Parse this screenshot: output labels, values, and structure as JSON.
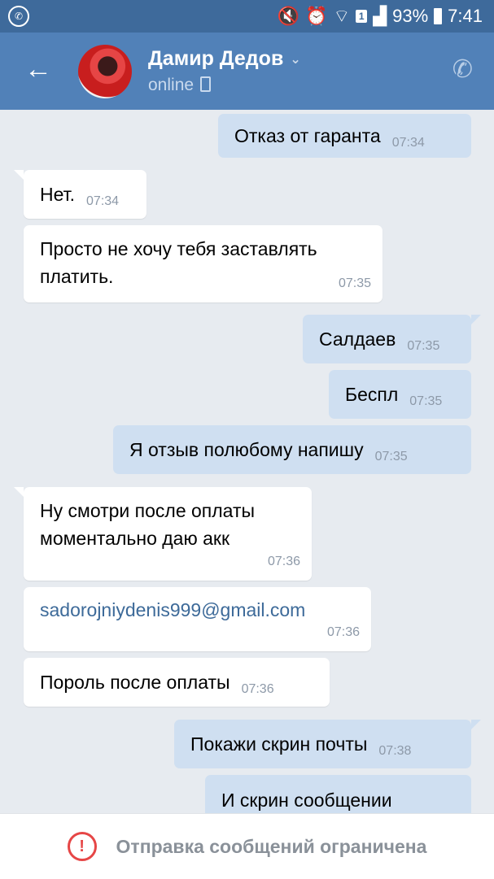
{
  "status_bar": {
    "battery": "93%",
    "time": "7:41",
    "sim": "1",
    "icons": [
      "whatsapp-icon",
      "mute-icon",
      "alarm-icon",
      "wifi-icon",
      "sim-icon",
      "signal-icon",
      "battery-icon"
    ]
  },
  "header": {
    "name": "Дамир Дедов",
    "status": "online"
  },
  "messages": [
    {
      "dir": "out",
      "text": "Отказ от гаранта",
      "time": "07:34"
    },
    {
      "dir": "in",
      "text": "Нет.",
      "time": "07:34"
    },
    {
      "dir": "in",
      "text": "Просто не хочу тебя заставлять платить.",
      "time": "07:35"
    },
    {
      "dir": "out",
      "text": "Салдаев",
      "time": "07:35"
    },
    {
      "dir": "out",
      "text": "Беспл",
      "time": "07:35"
    },
    {
      "dir": "out",
      "text": "Я отзыв полюбому напишу",
      "time": "07:35"
    },
    {
      "dir": "in",
      "text": "Ну смотри после оплаты моментально даю акк",
      "time": "07:36"
    },
    {
      "dir": "in",
      "text": "sadorojniydenis999@gmail.com",
      "time": "07:36",
      "link": true
    },
    {
      "dir": "in",
      "text": "Пороль после оплаты",
      "time": "07:36"
    },
    {
      "dir": "out",
      "text": "Покажи скрин почты",
      "time": "07:38"
    },
    {
      "dir": "out",
      "text": "И скрин сообщении",
      "time": ""
    }
  ],
  "bottom": {
    "text": "Отправка сообщений ограничена"
  },
  "colors": {
    "header": "#5181b8",
    "status_bar": "#3e6a9b",
    "outgoing_bubble": "#cfdff1",
    "incoming_bubble": "#ffffff",
    "background": "#e7ebf0",
    "warning": "#e64646"
  }
}
